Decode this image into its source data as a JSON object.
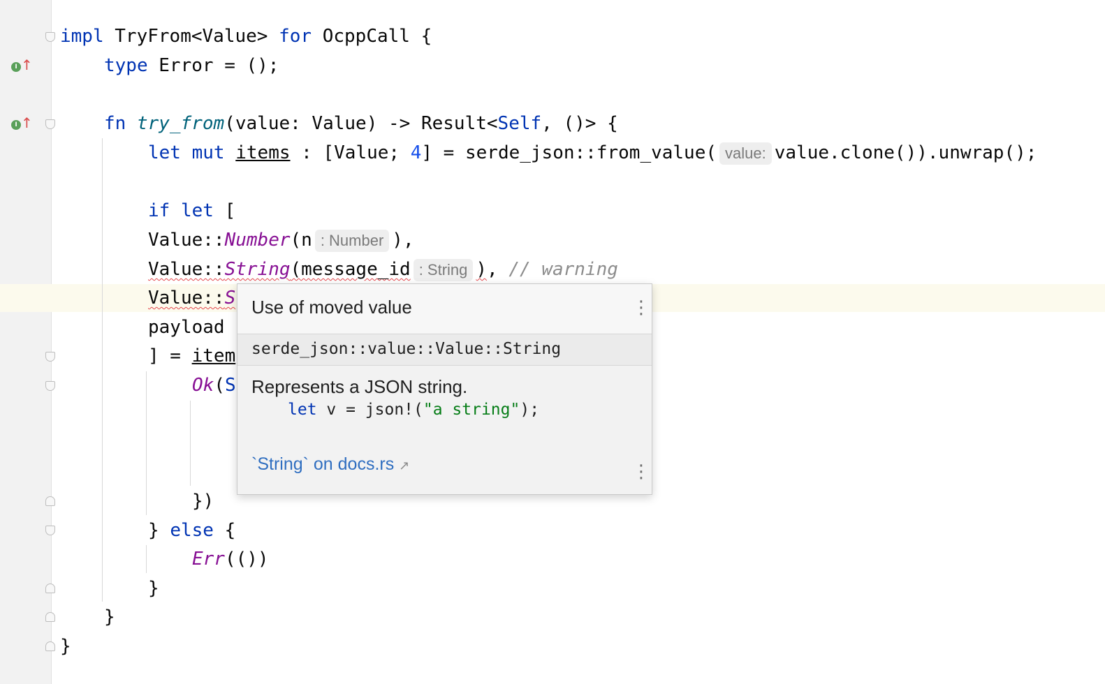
{
  "editor": {
    "language": "rust",
    "lines": {
      "l1": {
        "impl": "impl",
        "ty": "TryFrom<Value>",
        "for": "for",
        "name": "OcppCall",
        "brace": " {"
      },
      "l2": {
        "kw": "type",
        "rest": " Error = ();"
      },
      "l3": {
        "kw": "fn",
        "fn": "try_from",
        "args": "(value: Value) -> Result<",
        "self": "Self",
        "rest": ", ()> {"
      },
      "l4": {
        "let": "let",
        "mut": "mut",
        "var": "items",
        "mid": " : [Value; ",
        "num": "4",
        "call": "] = serde_json::from_value(",
        "hint": "value:",
        "tail": "value.clone()).unwrap();"
      },
      "l5": {
        "if": "if",
        "let": "let",
        "bracket": " ["
      },
      "l6": {
        "prefix": "Value::",
        "variant": "Number",
        "open": "(n",
        "hint": ": Number",
        "close": "),"
      },
      "l7": {
        "prefix": "Value::",
        "variant": "String",
        "open": "(message_id",
        "hint": ": String",
        "close": ")",
        "comma": ", ",
        "comment": "// warning"
      },
      "l8": {
        "prefix": "Value::",
        "variant": "S"
      },
      "l9": {
        "text": "payload"
      },
      "l10": {
        "pre": "] = ",
        "var": "item"
      },
      "l11": {
        "variant": "Ok",
        "open": "(",
        "self": "S"
      },
      "l12": {
        "text": "})"
      },
      "l13": {
        "brace": "} ",
        "else": "else",
        "open": " {"
      },
      "l14": {
        "variant": "Err",
        "rest": "(())"
      },
      "l15": {
        "text": "}"
      },
      "l16": {
        "text": "}"
      },
      "l17": {
        "text": "}"
      }
    }
  },
  "gutter": {
    "impl_marker_label": "I",
    "impl_marker_arrow": "↑"
  },
  "popup": {
    "title": "Use of moved value",
    "definition": "serde_json::value::Value::String",
    "description": "Represents a JSON string.",
    "code": {
      "kw": "let",
      "mid": " v = json!(",
      "str": "\"a string\"",
      "end": ");"
    },
    "link_text": "`String` on docs.rs",
    "link_arrow": "↗",
    "menu_glyph": "⋮"
  },
  "colors": {
    "keyword": "#0033b3",
    "function": "#00627a",
    "variant": "#871094",
    "number": "#1750eb",
    "comment": "#8c8c8c",
    "string": "#067d17",
    "error": "#e5484d",
    "link": "#2f6ec0"
  }
}
